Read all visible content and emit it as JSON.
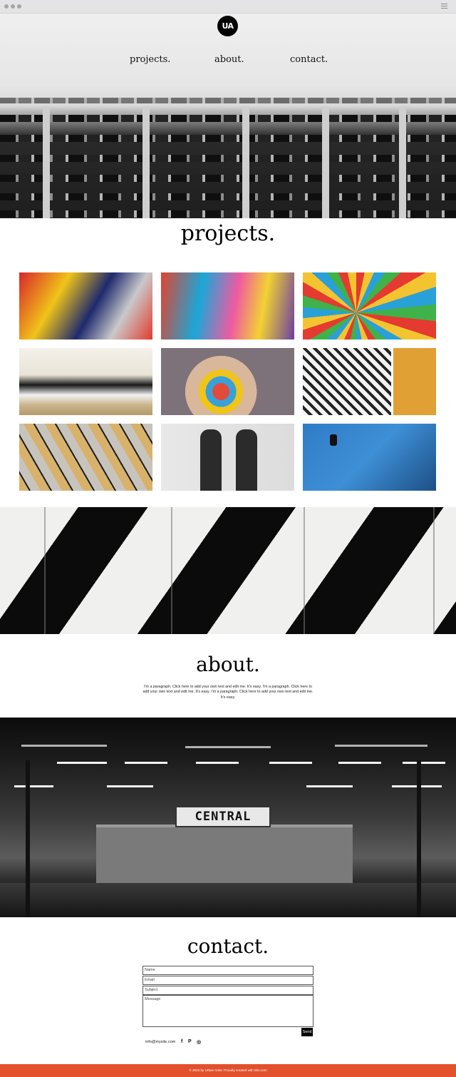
{
  "logo": {
    "text": "UA"
  },
  "nav": {
    "items": [
      {
        "label": "projects."
      },
      {
        "label": "about."
      },
      {
        "label": "contact."
      }
    ]
  },
  "projects": {
    "title": "projects."
  },
  "about": {
    "title": "about.",
    "paragraph": "I'm a paragraph. Click here to add your own text and edit me. It's easy. I'm a paragraph. Click here to add your own text and edit me. It's easy. I'm a paragraph. Click here to add your own text and edit me. It's easy."
  },
  "station": {
    "sign": "CENTRAL"
  },
  "contact": {
    "title": "contact.",
    "fields": {
      "name": "Name",
      "email": "Email",
      "subject": "Subject",
      "message": "Message"
    },
    "send_label": "Send",
    "email": "info@mysite.com",
    "social": {
      "facebook": "f",
      "pinterest": "P",
      "instagram": "◎"
    }
  },
  "footer": {
    "text": "© 2023 by Urban Artist. Proudly created with Wix.com"
  },
  "colors": {
    "footer": "#e2502c",
    "text": "#000000"
  },
  "icons": [
    "menu-icon",
    "facebook-icon",
    "pinterest-icon",
    "instagram-icon"
  ]
}
